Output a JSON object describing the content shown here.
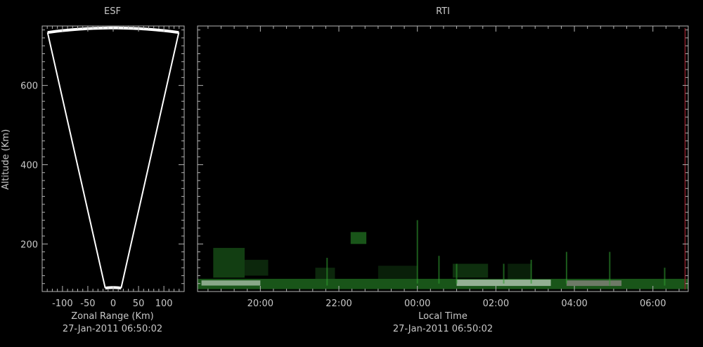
{
  "colors": {
    "background": "#000000",
    "axis": "#b4b4b4",
    "text": "#c8c8c8",
    "fan": "#ffffff",
    "echo_green": "#2e9a2e",
    "echo_white": "#e6ece6",
    "echo_pink": "#d8a8c8",
    "marker_red": "#8a1f2a"
  },
  "chart_data": [
    {
      "type": "scatter",
      "title": "ESF",
      "xlabel": "Zonal Range (Km)",
      "ylabel": "Altitude (Km)",
      "footer": "27-Jan-2011 06:50:02",
      "xlim": [
        -140,
        140
      ],
      "ylim": [
        80,
        750
      ],
      "x_ticks": [
        -100,
        -50,
        0,
        50,
        100
      ],
      "y_ticks": [
        200,
        400,
        600
      ],
      "grid": false,
      "beam_fan": {
        "outer_range_km": 745,
        "inner_range_km": 90,
        "half_angle_deg": 10
      }
    },
    {
      "type": "heatmap",
      "title": "RTI",
      "xlabel": "Local Time",
      "footer": "27-Jan-2011 06:50:02",
      "xlim": [
        18.4,
        30.9
      ],
      "ylim": [
        80,
        750
      ],
      "x_ticks": [
        {
          "value": 20,
          "label": "20:00"
        },
        {
          "value": 22,
          "label": "22:00"
        },
        {
          "value": 24,
          "label": "00:00"
        },
        {
          "value": 26,
          "label": "02:00"
        },
        {
          "value": 28,
          "label": "04:00"
        },
        {
          "value": 30,
          "label": "06:00"
        }
      ],
      "y_ticks": [
        200,
        400,
        600
      ],
      "grid": false,
      "echo_regions": [
        {
          "t0": 18.4,
          "t1": 30.9,
          "h0": 86,
          "h1": 112,
          "color": "echo_green",
          "opacity": 0.55
        },
        {
          "t0": 18.5,
          "t1": 20.0,
          "h0": 95,
          "h1": 108,
          "color": "echo_white",
          "opacity": 0.55
        },
        {
          "t0": 25.0,
          "t1": 27.4,
          "h0": 94,
          "h1": 110,
          "color": "echo_white",
          "opacity": 0.6
        },
        {
          "t0": 27.8,
          "t1": 29.2,
          "h0": 94,
          "h1": 108,
          "color": "echo_pink",
          "opacity": 0.45
        },
        {
          "t0": 18.8,
          "t1": 19.6,
          "h0": 115,
          "h1": 190,
          "color": "echo_green",
          "opacity": 0.4
        },
        {
          "t0": 19.6,
          "t1": 20.2,
          "h0": 120,
          "h1": 160,
          "color": "echo_green",
          "opacity": 0.25
        },
        {
          "t0": 21.4,
          "t1": 21.9,
          "h0": 112,
          "h1": 140,
          "color": "echo_green",
          "opacity": 0.25
        },
        {
          "t0": 22.3,
          "t1": 22.7,
          "h0": 200,
          "h1": 230,
          "color": "echo_green",
          "opacity": 0.55
        },
        {
          "t0": 23.0,
          "t1": 24.0,
          "h0": 112,
          "h1": 145,
          "color": "echo_green",
          "opacity": 0.2
        },
        {
          "t0": 24.9,
          "t1": 25.8,
          "h0": 115,
          "h1": 150,
          "color": "echo_green",
          "opacity": 0.3
        },
        {
          "t0": 26.3,
          "t1": 26.9,
          "h0": 110,
          "h1": 150,
          "color": "echo_green",
          "opacity": 0.2
        }
      ],
      "echo_streaks": [
        {
          "t": 21.7,
          "h0": 95,
          "h1": 165
        },
        {
          "t": 24.0,
          "h0": 100,
          "h1": 260
        },
        {
          "t": 24.55,
          "h0": 100,
          "h1": 170
        },
        {
          "t": 25.0,
          "h0": 100,
          "h1": 150
        },
        {
          "t": 26.2,
          "h0": 100,
          "h1": 150
        },
        {
          "t": 26.9,
          "h0": 100,
          "h1": 160
        },
        {
          "t": 27.8,
          "h0": 100,
          "h1": 180
        },
        {
          "t": 28.9,
          "h0": 95,
          "h1": 180
        },
        {
          "t": 30.3,
          "h0": 95,
          "h1": 140
        }
      ],
      "time_marker": {
        "t": 30.82,
        "h0": 85,
        "h1": 745
      }
    }
  ]
}
